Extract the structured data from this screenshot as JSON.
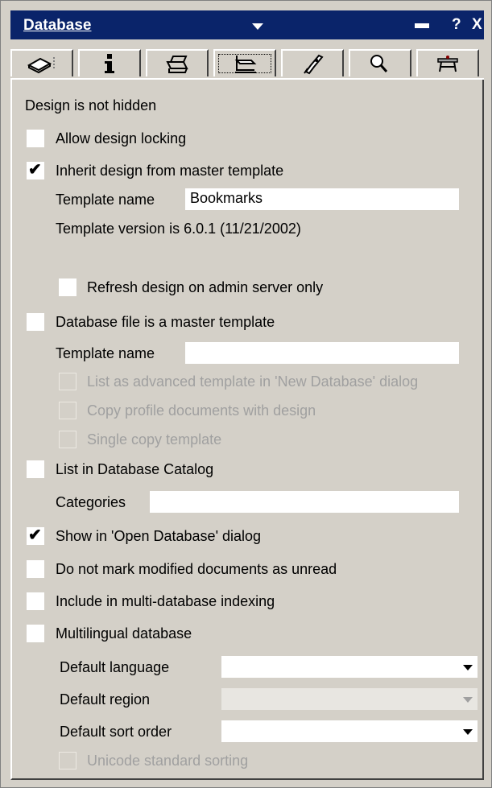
{
  "title": "Database",
  "title_buttons": {
    "help": "?",
    "close": "X"
  },
  "tabs": [
    {
      "icon": "database-info-icon"
    },
    {
      "icon": "info-icon"
    },
    {
      "icon": "printer-icon"
    },
    {
      "icon": "design-icon"
    },
    {
      "icon": "launch-icon"
    },
    {
      "icon": "search-icon"
    },
    {
      "icon": "advanced-icon"
    }
  ],
  "status": "Design is not hidden",
  "options": {
    "allow_locking": {
      "label": "Allow design locking",
      "checked": false
    },
    "inherit": {
      "label": "Inherit design from master template",
      "checked": true,
      "check": "✔"
    },
    "template_name_label": "Template name",
    "template_name_value": "Bookmarks",
    "template_version": "Template version is 6.0.1 (11/21/2002)",
    "refresh": {
      "label": "Refresh design on admin server only",
      "checked": false
    },
    "master": {
      "label": "Database file is a master template",
      "checked": false
    },
    "master_template_name_label": "Template name",
    "master_template_name_value": "",
    "advanced": {
      "label": "List as advanced template in 'New Database' dialog",
      "checked": false,
      "disabled": true
    },
    "copy_profile": {
      "label": "Copy profile documents with design",
      "checked": false,
      "disabled": true
    },
    "single_copy": {
      "label": "Single copy template",
      "checked": false,
      "disabled": true
    },
    "catalog": {
      "label": "List in Database Catalog",
      "checked": false
    },
    "categories_label": "Categories",
    "categories_value": "",
    "show_open": {
      "label": "Show in 'Open Database' dialog",
      "checked": true,
      "check": "✔"
    },
    "no_unread": {
      "label": "Do not mark modified documents as unread",
      "checked": false
    },
    "multi_index": {
      "label": "Include in multi-database indexing",
      "checked": false
    },
    "multilingual": {
      "label": "Multilingual database",
      "checked": false
    },
    "default_language_label": "Default language",
    "default_language_value": "",
    "default_region_label": "Default region",
    "default_region_value": "",
    "default_sort_label": "Default sort order",
    "default_sort_value": "",
    "unicode": {
      "label": "Unicode standard sorting",
      "checked": false,
      "disabled": true
    }
  }
}
